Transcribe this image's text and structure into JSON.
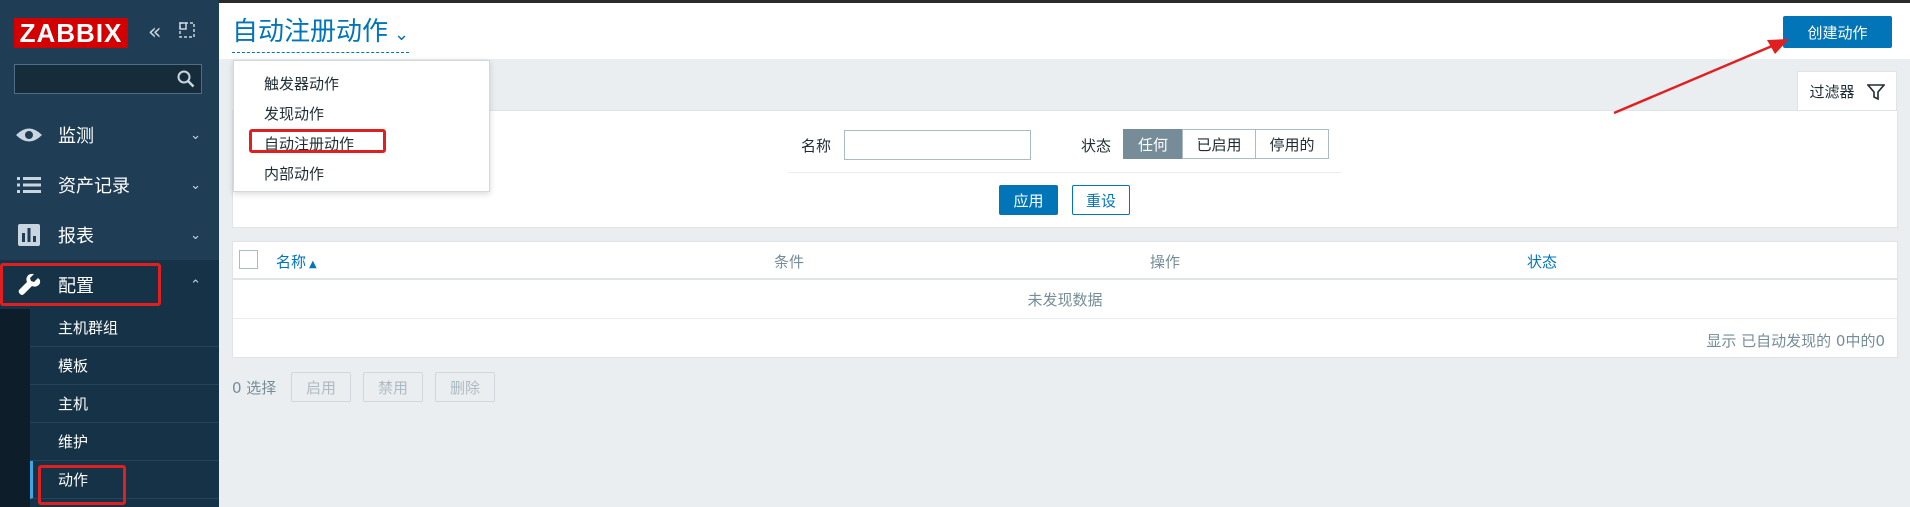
{
  "sidebar": {
    "logo": "ZABBIX",
    "search_placeholder": "",
    "menu": [
      {
        "label": "监测",
        "icon": "eye-icon"
      },
      {
        "label": "资产记录",
        "icon": "list-icon"
      },
      {
        "label": "报表",
        "icon": "report-icon"
      },
      {
        "label": "配置",
        "icon": "wrench-icon"
      }
    ],
    "submenu": [
      "主机群组",
      "模板",
      "主机",
      "维护",
      "动作"
    ]
  },
  "header": {
    "title": "自动注册动作",
    "create_button": "创建动作"
  },
  "dropdown": {
    "items": [
      "触发器动作",
      "发现动作",
      "自动注册动作",
      "内部动作"
    ]
  },
  "filter": {
    "tab_label": "过滤器",
    "name_label": "名称",
    "name_value": "",
    "status_label": "状态",
    "status_options": [
      "任何",
      "已启用",
      "停用的"
    ],
    "selected_status": "任何",
    "apply": "应用",
    "reset": "重设"
  },
  "table": {
    "columns": [
      "名称",
      "条件",
      "操作",
      "状态"
    ],
    "sort_indicator": "▲",
    "empty": "未发现数据",
    "paging": "显示 已自动发现的 0中的0"
  },
  "footer": {
    "selected": "0 选择",
    "buttons": [
      "启用",
      "禁用",
      "删除"
    ]
  },
  "colors": {
    "accent": "#0275b8",
    "sidebar": "#1f3e55",
    "highlight": "#e02020"
  }
}
